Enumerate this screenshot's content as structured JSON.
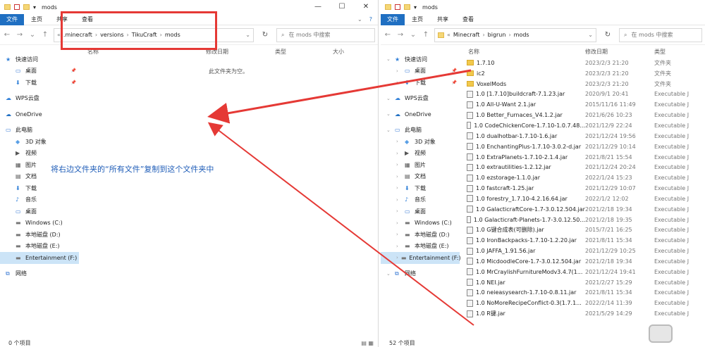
{
  "left": {
    "title": "mods",
    "tabs": [
      "文件",
      "主页",
      "共享",
      "查看"
    ],
    "path": [
      ".minecraft",
      "versions",
      "TikuCraft",
      "mods"
    ],
    "search_placeholder": "在 mods 中搜索",
    "columns": [
      "名称",
      "修改日期",
      "类型",
      "大小"
    ],
    "empty_text": "此文件夹为空。",
    "status": "0 个项目"
  },
  "right": {
    "title": "mods",
    "tabs": [
      "文件",
      "主页",
      "共享",
      "查看"
    ],
    "path": [
      "Minecraft",
      "bigrun",
      "mods"
    ],
    "search_placeholder": "在 mods 中搜索",
    "columns": [
      "名称",
      "修改日期",
      "类型"
    ],
    "status": "52 个项目",
    "files": [
      {
        "name": "1.7.10",
        "date": "2023/2/3 21:20",
        "type": "文件夹",
        "kind": "folder"
      },
      {
        "name": "ic2",
        "date": "2023/2/3 21:20",
        "type": "文件夹",
        "kind": "folder"
      },
      {
        "name": "VoxelMods",
        "date": "2023/2/3 21:20",
        "type": "文件夹",
        "kind": "folder"
      },
      {
        "name": "1.0 [1.7.10]buildcraft-7.1.23.jar",
        "date": "2020/9/1 20:41",
        "type": "Executable J",
        "kind": "jar"
      },
      {
        "name": "1.0 All-U-Want 2.1.jar",
        "date": "2015/11/16 11:49",
        "type": "Executable J",
        "kind": "jar"
      },
      {
        "name": "1.0 Better_Furnaces_V4.1.2.jar",
        "date": "2021/6/26 10:23",
        "type": "Executable J",
        "kind": "jar"
      },
      {
        "name": "1.0 CodeChickenCore-1.7.10-1.0.7.48...",
        "date": "2021/12/9 22:24",
        "type": "Executable J",
        "kind": "jar"
      },
      {
        "name": "1.0 dualhotbar-1.7.10-1.6.jar",
        "date": "2021/12/24 19:56",
        "type": "Executable J",
        "kind": "jar"
      },
      {
        "name": "1.0 EnchantingPlus-1.7.10-3.0.2-d.jar",
        "date": "2021/12/29 10:14",
        "type": "Executable J",
        "kind": "jar"
      },
      {
        "name": "1.0 ExtraPlanets-1.7.10-2.1.4.jar",
        "date": "2021/8/21 15:54",
        "type": "Executable J",
        "kind": "jar"
      },
      {
        "name": "1.0 extrautilities-1.2.12.jar",
        "date": "2021/12/24 20:24",
        "type": "Executable J",
        "kind": "jar"
      },
      {
        "name": "1.0 ezstorage-1.1.0.jar",
        "date": "2022/1/24 15:23",
        "type": "Executable J",
        "kind": "jar"
      },
      {
        "name": "1.0 fastcraft-1.25.jar",
        "date": "2021/12/29 10:07",
        "type": "Executable J",
        "kind": "jar"
      },
      {
        "name": "1.0 forestry_1.7.10-4.2.16.64.jar",
        "date": "2022/1/2 12:02",
        "type": "Executable J",
        "kind": "jar"
      },
      {
        "name": "1.0 GalacticraftCore-1.7-3.0.12.504.jar",
        "date": "2021/2/18 19:34",
        "type": "Executable J",
        "kind": "jar"
      },
      {
        "name": "1.0 Galacticraft-Planets-1.7-3.0.12.50...",
        "date": "2021/2/18 19:35",
        "type": "Executable J",
        "kind": "jar"
      },
      {
        "name": "1.0 G键合成表(可删除).jar",
        "date": "2015/7/21 16:25",
        "type": "Executable J",
        "kind": "jar"
      },
      {
        "name": "1.0 IronBackpacks-1.7.10-1.2.20.jar",
        "date": "2021/8/11 15:34",
        "type": "Executable J",
        "kind": "jar"
      },
      {
        "name": "1.0 JAFFA_1.91.56.jar",
        "date": "2021/12/29 10:25",
        "type": "Executable J",
        "kind": "jar"
      },
      {
        "name": "1.0 MicdoodleCore-1.7-3.0.12.504.jar",
        "date": "2021/2/18 19:34",
        "type": "Executable J",
        "kind": "jar"
      },
      {
        "name": "1.0 MrCraylishFurnitureModv3.4.7(1...",
        "date": "2021/12/24 19:41",
        "type": "Executable J",
        "kind": "jar"
      },
      {
        "name": "1.0 NEI.jar",
        "date": "2021/2/27 15:29",
        "type": "Executable J",
        "kind": "jar"
      },
      {
        "name": "1.0 neieasysearch-1.7.10-0.8.11.jar",
        "date": "2021/8/11 15:34",
        "type": "Executable J",
        "kind": "jar"
      },
      {
        "name": "1.0 NoMoreRecipeConflict-0.3(1.7.1...",
        "date": "2022/2/14 11:39",
        "type": "Executable J",
        "kind": "jar"
      },
      {
        "name": "1.0 R键.jar",
        "date": "2021/5/29 14:29",
        "type": "Executable J",
        "kind": "jar"
      }
    ]
  },
  "nav_items": [
    {
      "label": "快速访问",
      "indent": 0,
      "icon": "star-icon"
    },
    {
      "label": "桌面",
      "indent": 1,
      "icon": "desktop-icon",
      "pin": true
    },
    {
      "label": "下载",
      "indent": 1,
      "icon": "download-icon",
      "pin": true
    },
    {
      "gap": true
    },
    {
      "label": "WPS云盘",
      "indent": 0,
      "icon": "cloud-icon"
    },
    {
      "gap": true
    },
    {
      "label": "OneDrive",
      "indent": 0,
      "icon": "onedrive-icon"
    },
    {
      "gap": true
    },
    {
      "label": "此电脑",
      "indent": 0,
      "icon": "computer-icon"
    },
    {
      "label": "3D 对象",
      "indent": 1,
      "icon": "cube-icon"
    },
    {
      "label": "视频",
      "indent": 1,
      "icon": "video-icon"
    },
    {
      "label": "图片",
      "indent": 1,
      "icon": "image-icon"
    },
    {
      "label": "文档",
      "indent": 1,
      "icon": "document-icon"
    },
    {
      "label": "下载",
      "indent": 1,
      "icon": "download-icon"
    },
    {
      "label": "音乐",
      "indent": 1,
      "icon": "music-icon"
    },
    {
      "label": "桌面",
      "indent": 1,
      "icon": "desktop-icon"
    },
    {
      "label": "Windows (C:)",
      "indent": 1,
      "icon": "drive-icon"
    },
    {
      "label": "本地磁盘 (D:)",
      "indent": 1,
      "icon": "drive-icon"
    },
    {
      "label": "本地磁盘 (E:)",
      "indent": 1,
      "icon": "drive-icon"
    },
    {
      "label": "Entertainment (F:)",
      "indent": 1,
      "icon": "drive-icon",
      "selected": true
    },
    {
      "gap": true
    },
    {
      "label": "网络",
      "indent": 0,
      "icon": "network-icon"
    }
  ],
  "annotation": "将右边文件夹的“所有文件”复制到这个文件夹中",
  "colors": {
    "accent": "#1f6fc2",
    "arrow": "#e53935",
    "annotation": "#1f5db8"
  }
}
